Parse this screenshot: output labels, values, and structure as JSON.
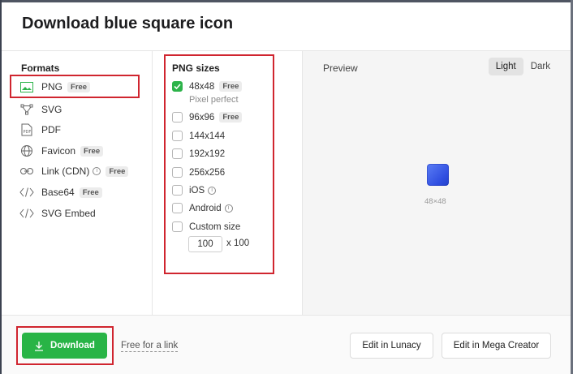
{
  "dialog": {
    "title": "Download blue square icon"
  },
  "formats": {
    "heading": "Formats",
    "items": [
      {
        "label": "PNG",
        "badge": "Free",
        "icon": "image-icon"
      },
      {
        "label": "SVG",
        "badge": "",
        "icon": "vector-icon"
      },
      {
        "label": "PDF",
        "badge": "",
        "icon": "pdf-icon"
      },
      {
        "label": "Favicon",
        "badge": "Free",
        "icon": "globe-icon"
      },
      {
        "label": "Link (CDN)",
        "badge": "Free",
        "icon": "link-icon"
      },
      {
        "label": "Base64",
        "badge": "Free",
        "icon": "code-icon"
      },
      {
        "label": "SVG Embed",
        "badge": "",
        "icon": "code-icon"
      }
    ]
  },
  "png_sizes": {
    "heading": "PNG sizes",
    "items": [
      {
        "label": "48x48",
        "badge": "Free",
        "checked": true,
        "sub": "Pixel perfect"
      },
      {
        "label": "96x96",
        "badge": "Free",
        "checked": false
      },
      {
        "label": "144x144",
        "checked": false
      },
      {
        "label": "192x192",
        "checked": false
      },
      {
        "label": "256x256",
        "checked": false
      },
      {
        "label": "iOS",
        "checked": false
      },
      {
        "label": "Android",
        "checked": false
      },
      {
        "label": "Custom size",
        "checked": false
      }
    ],
    "custom_value": "100",
    "custom_suffix": "x 100"
  },
  "preview": {
    "heading": "Preview",
    "theme_light": "Light",
    "theme_dark": "Dark",
    "active_theme": "Light",
    "size_label": "48×48",
    "icon_color": "#3f5ff0"
  },
  "footer": {
    "download_label": "Download",
    "free_link": "Free for a link",
    "edit_lunacy": "Edit in Lunacy",
    "edit_mega": "Edit in Mega Creator"
  },
  "colors": {
    "accent_green": "#28b446",
    "highlight_red": "#d0252f"
  }
}
